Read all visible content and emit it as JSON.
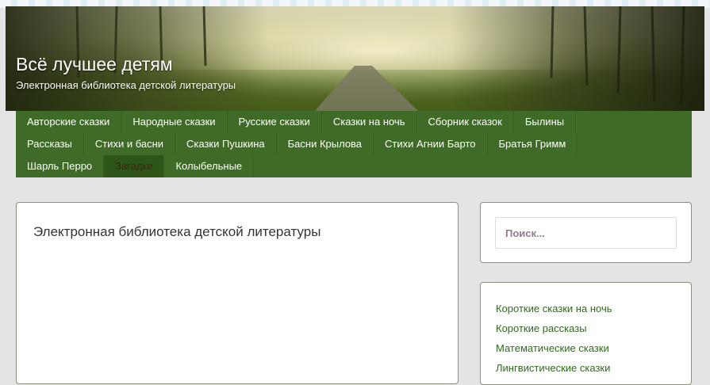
{
  "site": {
    "title": "Всё лучшее детям",
    "description": "Электронная библиотека детской литературы"
  },
  "nav": {
    "rows": [
      [
        "Авторские сказки",
        "Народные сказки",
        "Русские сказки",
        "Сказки на ночь",
        "Сборник сказок",
        "Былины"
      ],
      [
        "Рассказы",
        "Стихи и басни",
        "Сказки Пушкина",
        "Басни Крылова",
        "Стихи Агнии Барто",
        "Братья Гримм"
      ],
      [
        "Шарль Перро",
        "Загадки",
        "Колыбельные"
      ]
    ],
    "active": "Загадки"
  },
  "main": {
    "heading": "Электронная библиотека детской литературы"
  },
  "sidebar": {
    "search_placeholder": "Поиск...",
    "links": [
      "Короткие сказки на ночь",
      "Короткие рассказы",
      "Математические сказки",
      "Лингвистические сказки"
    ]
  },
  "colors": {
    "nav_bg": "#3f6a27",
    "link": "#2e6b1c",
    "page_bg": "#e4e4e4"
  }
}
